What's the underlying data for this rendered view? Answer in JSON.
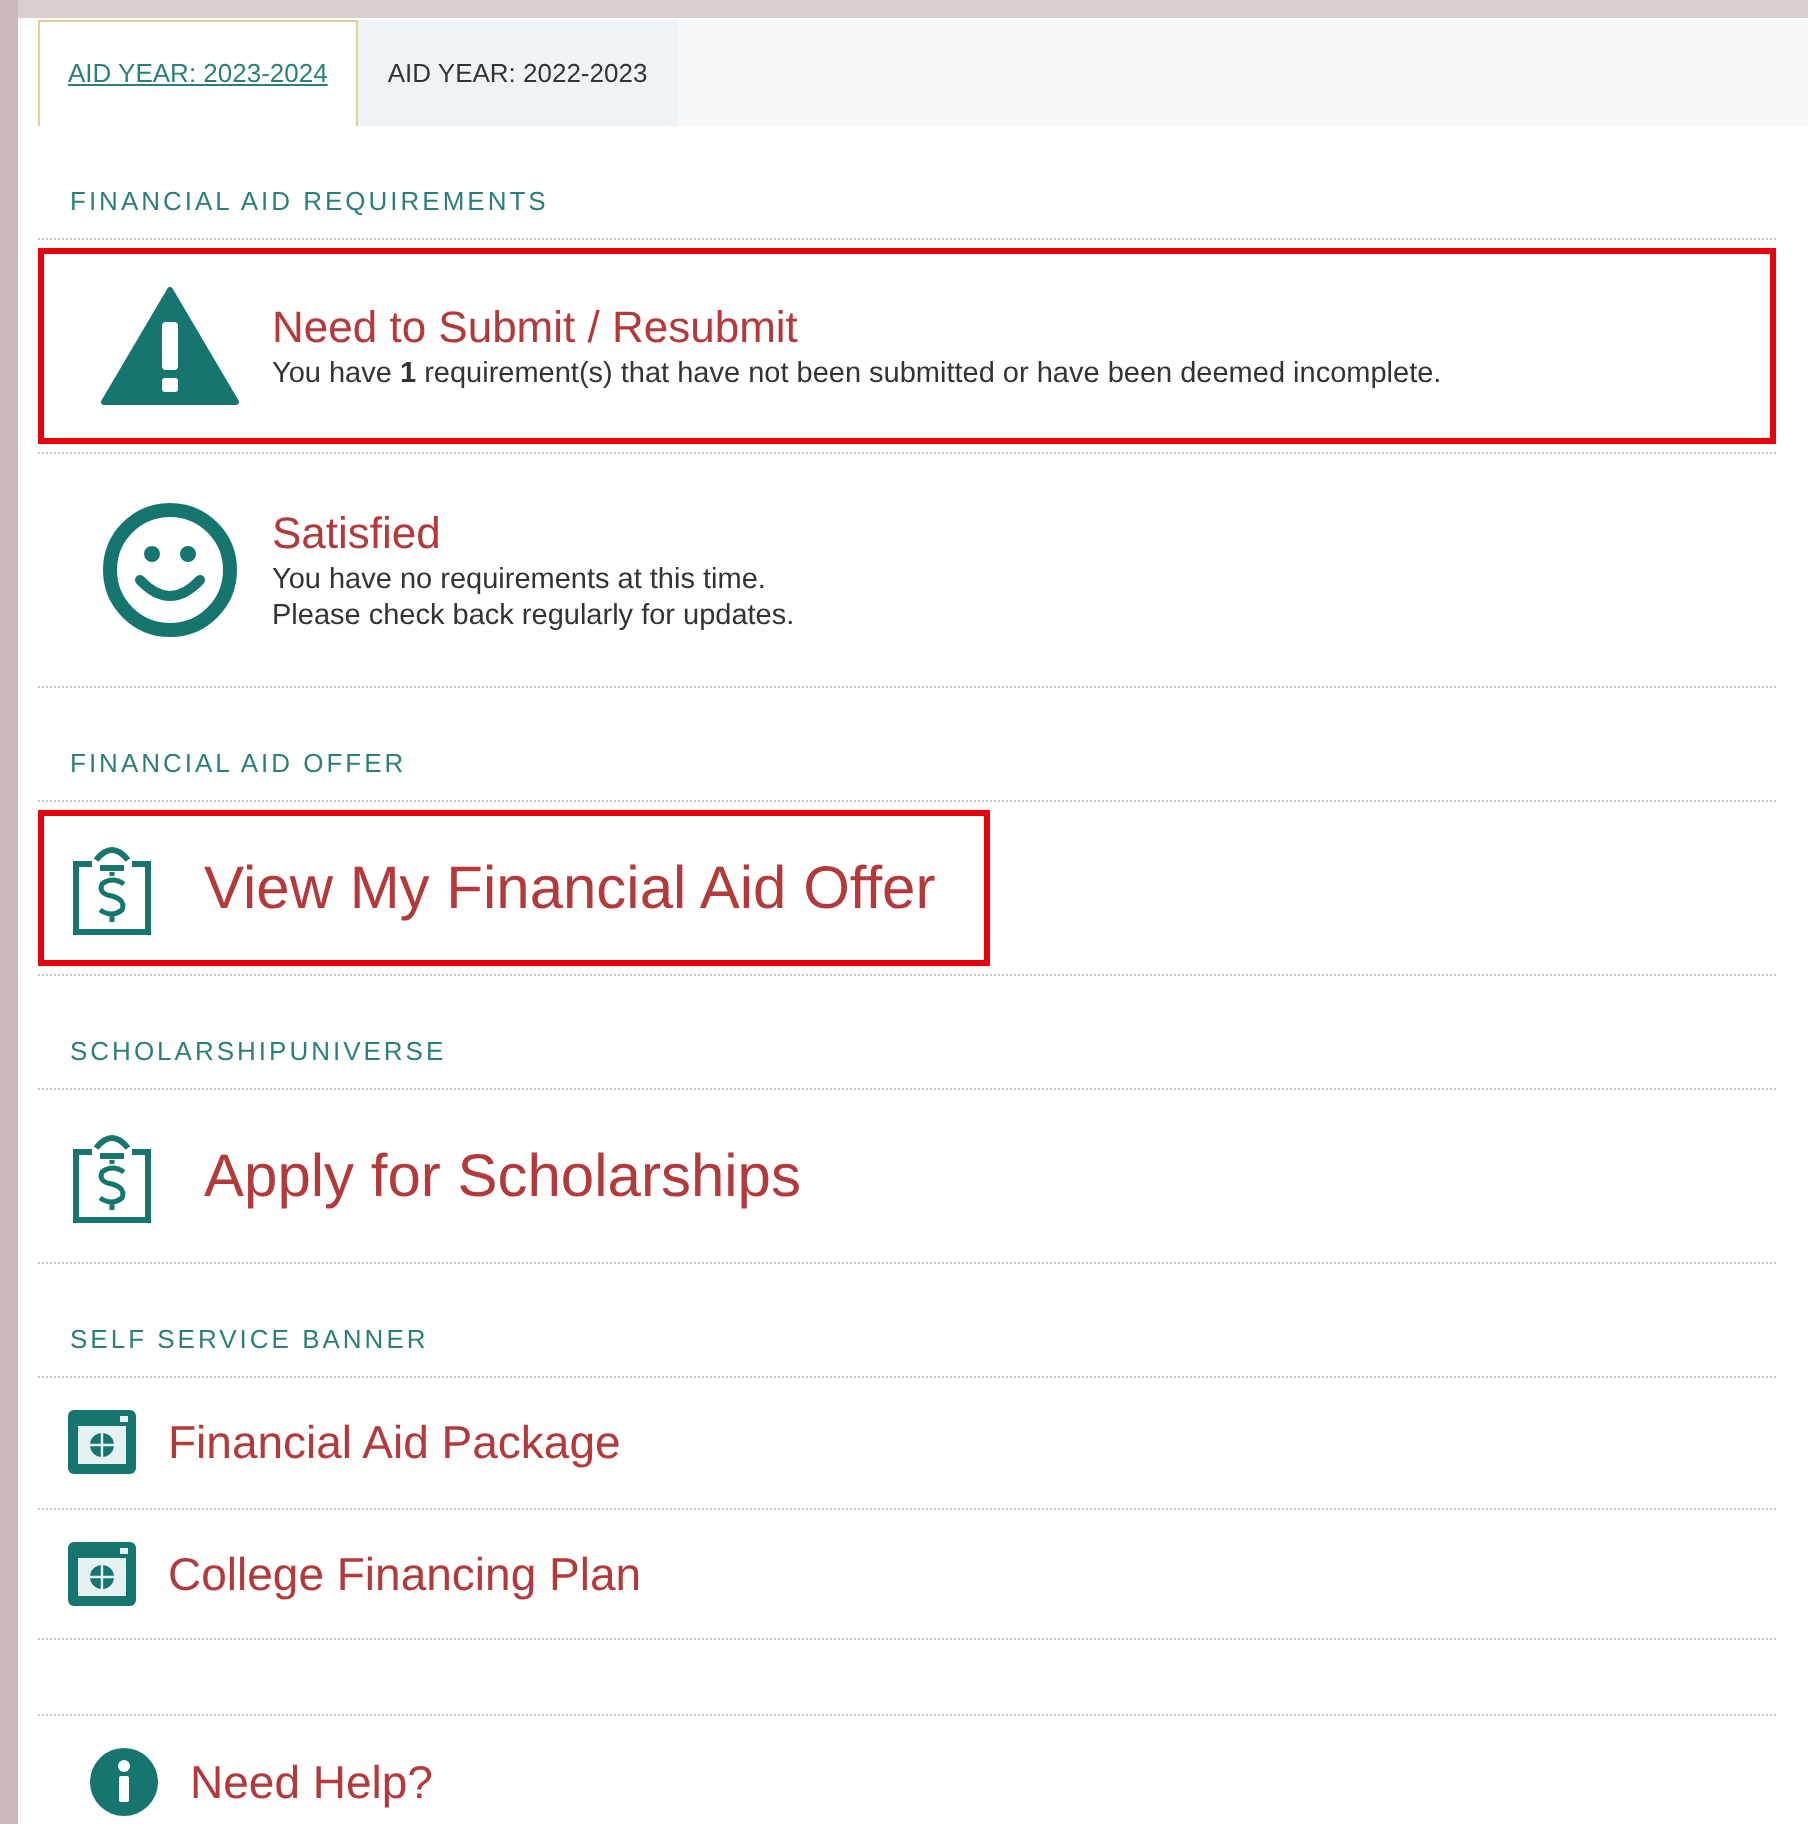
{
  "tabs": [
    {
      "label": "AID YEAR: 2023-2024",
      "selected": true
    },
    {
      "label": "AID YEAR: 2022-2023",
      "selected": false
    }
  ],
  "sections": [
    {
      "title": "FINANCIAL AID REQUIREMENTS",
      "items": [
        {
          "kind": "warning",
          "title": "Need to Submit / Resubmit",
          "lines": [
            "You have **1** requirement(s) that have not been submitted or have been deemed incomplete."
          ],
          "highlighted": true
        },
        {
          "kind": "satisfied",
          "title": "Satisfied",
          "lines": [
            "You have no requirements at this time.",
            "Please check back regularly for updates."
          ],
          "highlighted": false
        }
      ]
    },
    {
      "title": "FINANCIAL AID OFFER",
      "items": [
        {
          "kind": "offer",
          "title": "View My Financial Aid Offer",
          "highlighted": true
        }
      ]
    },
    {
      "title": "SCHOLARSHIPUNIVERSE",
      "items": [
        {
          "kind": "offer",
          "title": "Apply for Scholarships",
          "highlighted": false
        }
      ]
    },
    {
      "title": "SELF SERVICE BANNER",
      "items": [
        {
          "kind": "banner",
          "title": "Financial Aid Package",
          "highlighted": false
        },
        {
          "kind": "banner",
          "title": "College Financing Plan",
          "highlighted": false
        }
      ]
    }
  ],
  "help": {
    "title": "Need Help?"
  }
}
